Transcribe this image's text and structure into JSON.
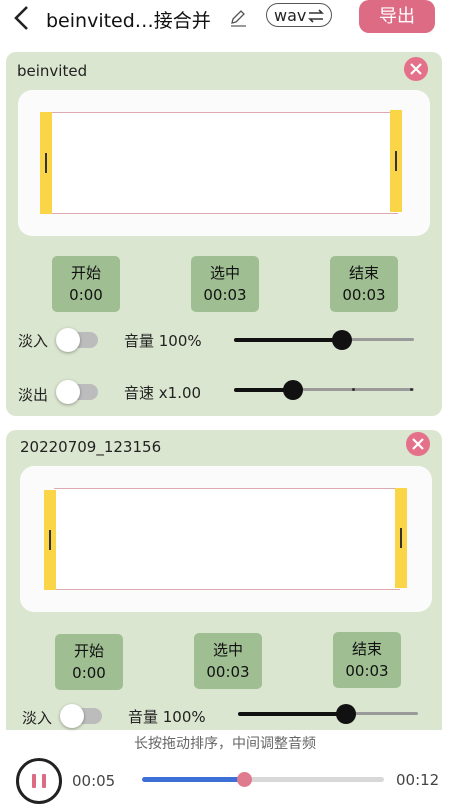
{
  "header": {
    "title": "beinvited…接合并",
    "format": "wav",
    "export_label": "导出"
  },
  "clips": [
    {
      "name": "beinvited",
      "start_label": "开始",
      "start_time": "0:00",
      "select_label": "选中",
      "select_time": "00:03",
      "end_label": "结束",
      "end_time": "00:03",
      "fade_in_label": "淡入",
      "volume_label": "音量 100%",
      "volume_level": 0.6,
      "fade_out_label": "淡出",
      "speed_label": "音速 x1.00",
      "speed_level": 0.33
    },
    {
      "name": "20220709_123156",
      "start_label": "开始",
      "start_time": "0:00",
      "select_label": "选中",
      "select_time": "00:03",
      "end_label": "结束",
      "end_time": "00:03",
      "fade_in_label": "淡入",
      "volume_label": "音量 100%",
      "volume_level": 0.6
    }
  ],
  "playback": {
    "hint": "长按拖动排序，中间调整音频",
    "current_time": "00:05",
    "total_time": "00:12",
    "progress": 0.42
  },
  "colors": {
    "accent": "#de6b84",
    "card": "#dbe6d0",
    "time_button": "#9fbf93",
    "handle": "#f9d547",
    "progress": "#3e6fd6"
  }
}
